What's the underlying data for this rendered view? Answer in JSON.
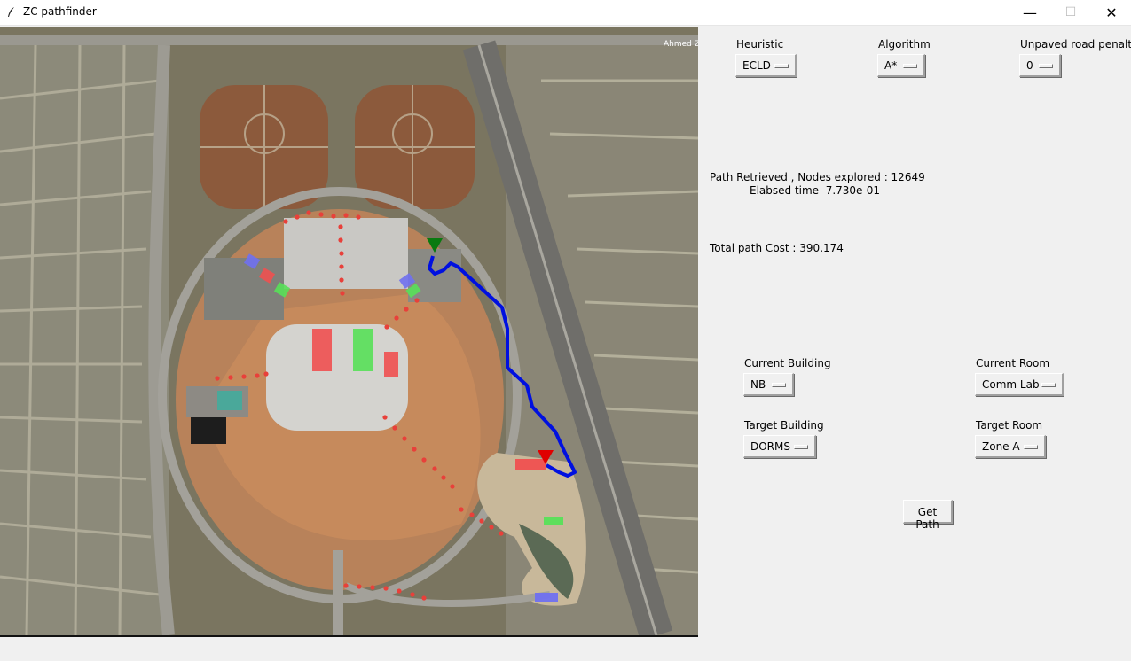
{
  "window": {
    "title": "ZC pathfinder",
    "minimize_icon": "minimize-icon",
    "maximize_icon": "maximize-icon",
    "close_icon": "close-icon"
  },
  "map": {
    "road_label": "Ahmed Z",
    "colors": {
      "path": "#0010e0",
      "dots": "#e8403a",
      "start_marker": "#0a7a10",
      "end_marker": "#e00000",
      "building_red": "#f05050",
      "building_green": "#58e058",
      "building_blue": "#7070f0"
    }
  },
  "controls": {
    "heuristic": {
      "label": "Heuristic",
      "value": "ECLD"
    },
    "algorithm": {
      "label": "Algorithm",
      "value": "A*"
    },
    "penalty": {
      "label": "Unpaved road penalty",
      "value": "0"
    },
    "current_building": {
      "label": "Current Building",
      "value": "NB"
    },
    "current_room": {
      "label": "Current Room",
      "value": "Comm Lab"
    },
    "target_building": {
      "label": "Target Building",
      "value": "DORMS"
    },
    "target_room": {
      "label": "Target Room",
      "value": "Zone A"
    },
    "get_path": "Get Path"
  },
  "status": {
    "line1": "Path Retrieved , Nodes explored : 12649",
    "line2": "Elabsed time  7.730e-01",
    "total_cost": "Total path Cost : 390.174"
  }
}
